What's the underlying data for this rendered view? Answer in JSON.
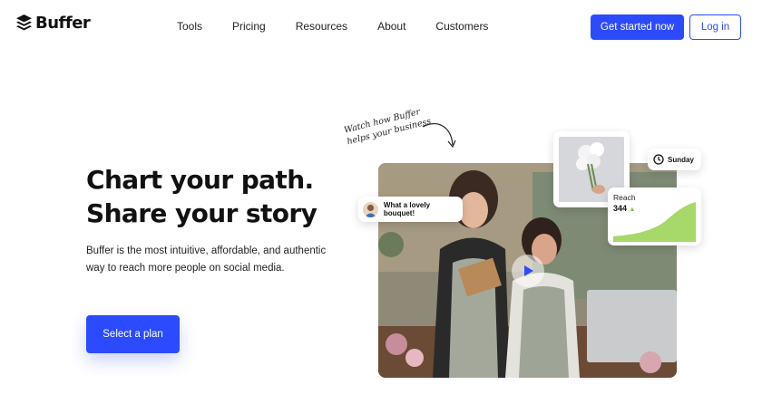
{
  "brand": {
    "name": "Buffer",
    "accent": "#2c4bff"
  },
  "nav": {
    "items": [
      "Tools",
      "Pricing",
      "Resources",
      "About",
      "Customers"
    ],
    "cta_label": "Get started now",
    "login_label": "Log in"
  },
  "hero": {
    "title_line1": "Chart your path.",
    "title_line2": "Share your story",
    "subtitle": "Buffer is the most intuitive, affordable, and authentic way to reach more people on social media.",
    "cta_label": "Select a plan"
  },
  "media": {
    "note_line1": "Watch how Buffer",
    "note_line2": "helps your business",
    "comment_text": "What a lovely bouquet!",
    "schedule_day": "Sunday",
    "reach_label": "Reach",
    "reach_value": "344",
    "reach_trend_icon": "triangle-up-icon",
    "play_icon": "play-icon",
    "clock_icon": "clock-icon",
    "chart_color": "#a6d86a"
  }
}
